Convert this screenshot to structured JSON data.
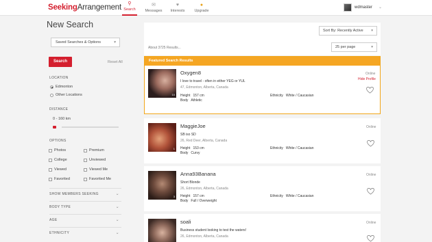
{
  "header": {
    "logo_part1": "Seeking",
    "logo_part2": "Arrangement",
    "nav": [
      {
        "label": "Search",
        "icon": "search-icon"
      },
      {
        "label": "Messages",
        "icon": "messages-icon"
      },
      {
        "label": "Interests",
        "icon": "heart-icon"
      },
      {
        "label": "Upgrade",
        "icon": "lock-icon"
      }
    ],
    "username": "wdmaster"
  },
  "sidebar": {
    "title": "New Search",
    "saved_searches": "Saved Searches & Options",
    "search_button": "Search",
    "reset_all": "Reset All",
    "location_label": "LOCATION",
    "location_options": [
      "Edmonton",
      "Other Locations"
    ],
    "distance_label": "DISTANCE",
    "distance_value": "0 - 160 km",
    "options_label": "OPTIONS",
    "options": [
      "Photos",
      "Premium",
      "College",
      "Unviewed",
      "Viewed",
      "Viewed Me",
      "Favorited",
      "Favorited Me"
    ],
    "accordions": [
      "SHOW MEMBERS SEEKING",
      "BODY TYPE",
      "AGE",
      "ETHNICITY"
    ]
  },
  "results": {
    "sort_label": "Sort By: Recently Active",
    "count_text": "About 3725 Results...",
    "per_page": "25 per page",
    "featured_header": "Featured Search Results",
    "height_label": "Height",
    "body_label": "Body",
    "ethnicity_label": "Ethnicity",
    "profiles": [
      {
        "name": "Oxygen8",
        "tagline": "I love to travel - often in either YEG or YUL",
        "location": "47, Edmonton, Alberta, Canada",
        "height": "157 cm",
        "body": "Athletic",
        "ethnicity": "White / Caucasian",
        "status": "Online",
        "hidden": "Hide Profile",
        "photos": "10"
      },
      {
        "name": "MaggieJoe",
        "tagline": "SB iso SD",
        "location": "26, Red Deer, Alberta, Canada",
        "height": "153 cm",
        "body": "Curvy",
        "ethnicity": "White / Caucasian",
        "status": "Online",
        "photos": "1"
      },
      {
        "name": "Anna93Banana",
        "tagline": "Short Blonde",
        "location": "26, Edmonton, Alberta, Canada",
        "height": "157 cm",
        "body": "Full / Overweight",
        "ethnicity": "White / Caucasian",
        "status": "Online",
        "photos": "3"
      },
      {
        "name": "soali",
        "tagline": "Business student looking to test the waters!",
        "location": "26, Edmonton, Alberta, Canada",
        "status": "Online"
      }
    ]
  }
}
